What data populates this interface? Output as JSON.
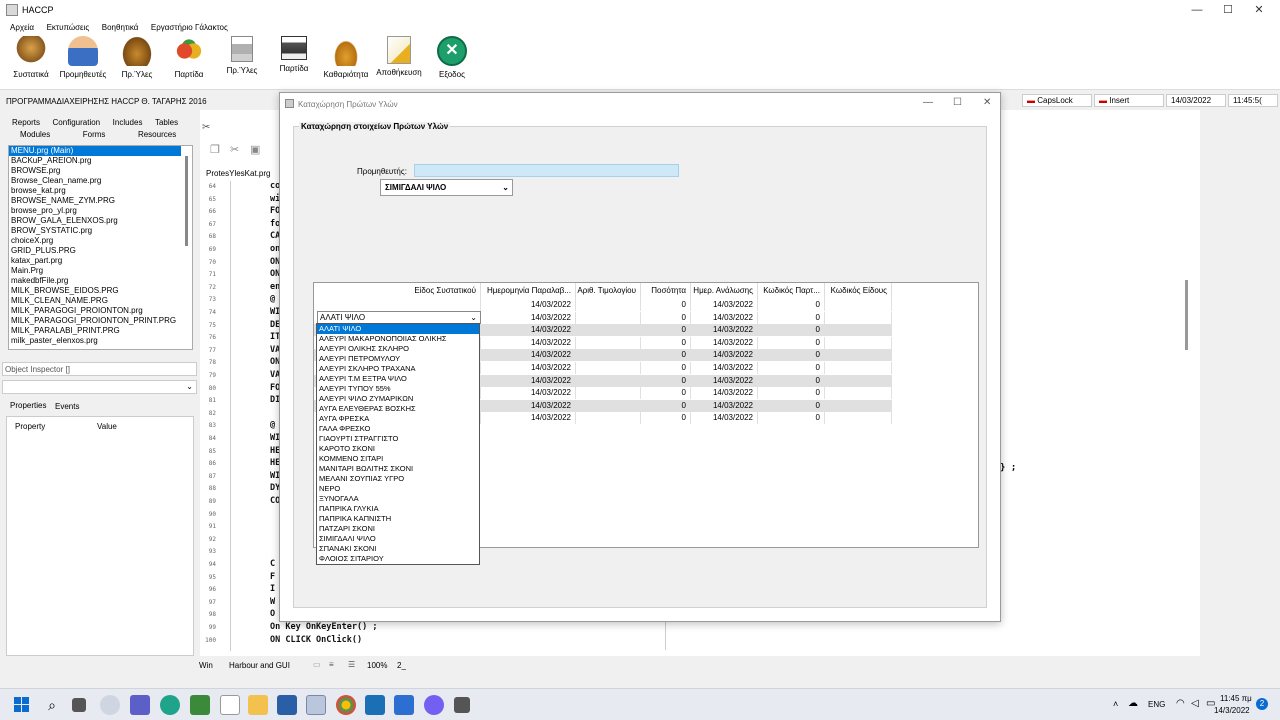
{
  "app": {
    "title": "HACCP",
    "menu": [
      "Αρχεία",
      "Εκτυπώσεις",
      "Βοηθητικά",
      "Εργαστήριο Γάλακτος"
    ],
    "toolbar": [
      "Συστατικά",
      "Προμηθευτές",
      "Πρ.Ύλες",
      "Παρτίδα",
      "Πρ.Ύλες",
      "Παρτίδα",
      "Καθαριότητα",
      "Αποθήκευση",
      "Εξοδος"
    ]
  },
  "infobar": {
    "left_text": "ΠΡΟΓΡΑΜΜΑΔΙΑΧΕΙΡΗΣΗΣ HACCP Θ. ΤΑΓΑΡΗΣ 2016",
    "capslock": "CapsLock",
    "insert": "Insert",
    "date": "14/03/2022",
    "time": "11:45:5("
  },
  "ide": {
    "tabs_row1": [
      "Reports",
      "Configuration",
      "Includes",
      "Tables"
    ],
    "tabs_row2": [
      "Modules",
      "Forms",
      "Resources"
    ],
    "files": [
      "MENU.prg (Main)",
      "BACKuP_AREION.prg",
      "BROWSE.prg",
      "Browse_Clean_name.prg",
      "browse_kat.prg",
      "BROWSE_NAME_ZYM.PRG",
      "browse_pro_yl.prg",
      "BROW_GALA_ELENXOS.prg",
      "BROW_SYSTATIC.prg",
      "choiceX.prg",
      "GRID_PLUS.PRG",
      "katax_part.prg",
      "Main.Prg",
      "makedbfFile.prg",
      "MILK_BROWSE_EIDOS.PRG",
      "MILK_CLEAN_NAME.PRG",
      "MILK_PARAGOGI_PROIONTON.prg",
      "MILK_PARAGOGI_PROIONTON_PRINT.PRG",
      "MILK_PARALABI_PRINT.PRG",
      "milk_paster_elenxos.prg"
    ],
    "object_inspector": "Object Inspector []",
    "insp_tabs": [
      "Properties",
      "Events"
    ],
    "insp_cols": [
      "Property",
      "Value"
    ],
    "editor_tab": "ProtesYlesKat.prg",
    "line_numbers": [
      "64",
      "65",
      "66",
      "67",
      "68",
      "69",
      "70",
      "71",
      "72",
      "73",
      "74",
      "75",
      "76",
      "77",
      "78",
      "79",
      "80",
      "81",
      "82",
      "83",
      "84",
      "85",
      "86",
      "87",
      "88",
      "89",
      "90",
      "91",
      "92",
      "93",
      "94",
      "95",
      "96",
      "97",
      "98",
      "99",
      "100"
    ],
    "code_fragments": [
      "co",
      "wi",
      "FO",
      "fo",
      "CA",
      "on",
      "ON",
      "ON",
      "end",
      "@ 95,",
      "WI",
      "DE",
      "IT",
      "VA",
      "ON",
      "VA",
      "FO",
      "DI",
      "",
      "@ 1",
      "WI",
      "HE",
      "HE",
      "WI",
      "DY",
      "CO",
      "",
      "",
      "",
      "",
      "C",
      "F",
      "I",
      "W",
      "O",
      "On Key OnKeyEnter() ;",
      "ON CLICK OnClick()"
    ],
    "right_code": "} ;",
    "status": [
      "Win",
      "Harbour and GUI",
      "100%",
      "2_"
    ]
  },
  "dialog": {
    "title": "Καταχώρηση Πρώτων Υλών",
    "group_title": "Καταχώρηση στοιχείων Πρώτων Υλών",
    "supplier_label": "Προμηθευτής:",
    "supplier_value": "",
    "combo_value": "ΣΙΜΙΓΔΑΛΙ ΨΙΛΟ",
    "columns": [
      "Είδος Συστατικού",
      "Ημερομηνία Παραλαβ...",
      "Αριθ. Τιμολογίου",
      "Ποσότητα",
      "Ημερ. Ανάλωσης",
      "Κωδικός Παρτ...",
      "Κωδικός Είδους"
    ],
    "rows": [
      {
        "item": "",
        "date": "14/03/2022",
        "invoice": "",
        "qty": "0",
        "use_date": "14/03/2022",
        "batch": "0",
        "code": ""
      },
      {
        "item": "ΑΛΑΤΙ ΨΙΛΟ",
        "date": "14/03/2022",
        "invoice": "",
        "qty": "0",
        "use_date": "14/03/2022",
        "batch": "0",
        "code": ""
      },
      {
        "item": "",
        "date": "14/03/2022",
        "invoice": "",
        "qty": "0",
        "use_date": "14/03/2022",
        "batch": "0",
        "code": ""
      },
      {
        "item": "",
        "date": "14/03/2022",
        "invoice": "",
        "qty": "0",
        "use_date": "14/03/2022",
        "batch": "0",
        "code": ""
      },
      {
        "item": "",
        "date": "14/03/2022",
        "invoice": "",
        "qty": "0",
        "use_date": "14/03/2022",
        "batch": "0",
        "code": ""
      },
      {
        "item": "",
        "date": "14/03/2022",
        "invoice": "",
        "qty": "0",
        "use_date": "14/03/2022",
        "batch": "0",
        "code": ""
      },
      {
        "item": "",
        "date": "14/03/2022",
        "invoice": "",
        "qty": "0",
        "use_date": "14/03/2022",
        "batch": "0",
        "code": ""
      },
      {
        "item": "",
        "date": "14/03/2022",
        "invoice": "",
        "qty": "0",
        "use_date": "14/03/2022",
        "batch": "0",
        "code": ""
      },
      {
        "item": "",
        "date": "14/03/2022",
        "invoice": "",
        "qty": "0",
        "use_date": "14/03/2022",
        "batch": "0",
        "code": ""
      },
      {
        "item": "",
        "date": "14/03/2022",
        "invoice": "",
        "qty": "0",
        "use_date": "14/03/2022",
        "batch": "0",
        "code": ""
      }
    ],
    "dropdown_options": [
      "ΑΛΑΤΙ ΨΙΛΟ",
      "ΑΛΕΥΡΙ ΜΑΚΑΡΟΝΟΠΟΙΙΑΣ ΟΛΙΚΗΣ",
      "ΑΛΕΥΡΙ ΟΛΙΚΗΣ ΣΚΛΗΡΟ",
      "ΑΛΕΥΡΙ ΠΕΤΡΟΜΥΛΟΥ",
      "ΑΛΕΥΡΙ ΣΚΛΗΡΟ ΤΡΑΧΑΝΑ",
      "ΑΛΕΥΡΙ Τ.Μ ΕΞΤΡΑ ΨΙΛΟ",
      "ΑΛΕΥΡΙ ΤΥΠΟΥ 55%",
      "ΑΛΕΥΡΙ ΨΙΛΟ ΖΥΜΑΡΙΚΩΝ",
      "ΑΥΓΑ ΕΛΕΥΘΕΡΑΣ ΒΟΣΚΗΣ",
      "ΑΥΓΑ ΦΡΕΣΚΑ",
      "ΓΑΛΑ ΦΡΕΣΚΟ",
      "ΓΙΑΟΥΡΤΙ ΣΤΡΑΓΓΙΣΤΟ",
      "ΚΑΡΟΤΟ ΣΚΟΝΙ",
      "ΚΟΜΜΕΝΟ ΣΙΤΑΡΙ",
      "ΜΑΝΙΤΑΡΙ ΒΩΛΙΤΗΣ ΣΚΟΝΙ",
      "ΜΕΛΑΝΙ ΣΟΥΠΙΑΣ ΥΓΡΟ",
      "ΝΕΡΟ",
      "ΞΥΝΟΓΑΛΑ",
      "ΠΑΠΡΙΚΑ ΓΛΥΚΙΑ",
      "ΠΑΠΡΙΚΑ ΚΑΠΝΙΣΤΗ",
      "ΠΑΤΖΑΡΙ ΣΚΟΝΙ",
      "ΣΙΜΙΓΔΑΛΙ ΨΙΛΟ",
      "ΣΠΑΝΑΚΙ ΣΚΟΝΙ",
      "ΦΛΟΙΟΣ ΣΙΤΑΡΙΟΥ"
    ],
    "dropdown_selected": "ΑΛΑΤΙ ΨΙΛΟ"
  },
  "taskbar": {
    "lang": "ENG",
    "time": "11:45 πμ",
    "date": "14/3/2022",
    "notif": "2"
  },
  "colors": {
    "accent": "#0078d7",
    "supplier_field": "#cfe8f7",
    "exit_icon": "#1e9e6a"
  }
}
